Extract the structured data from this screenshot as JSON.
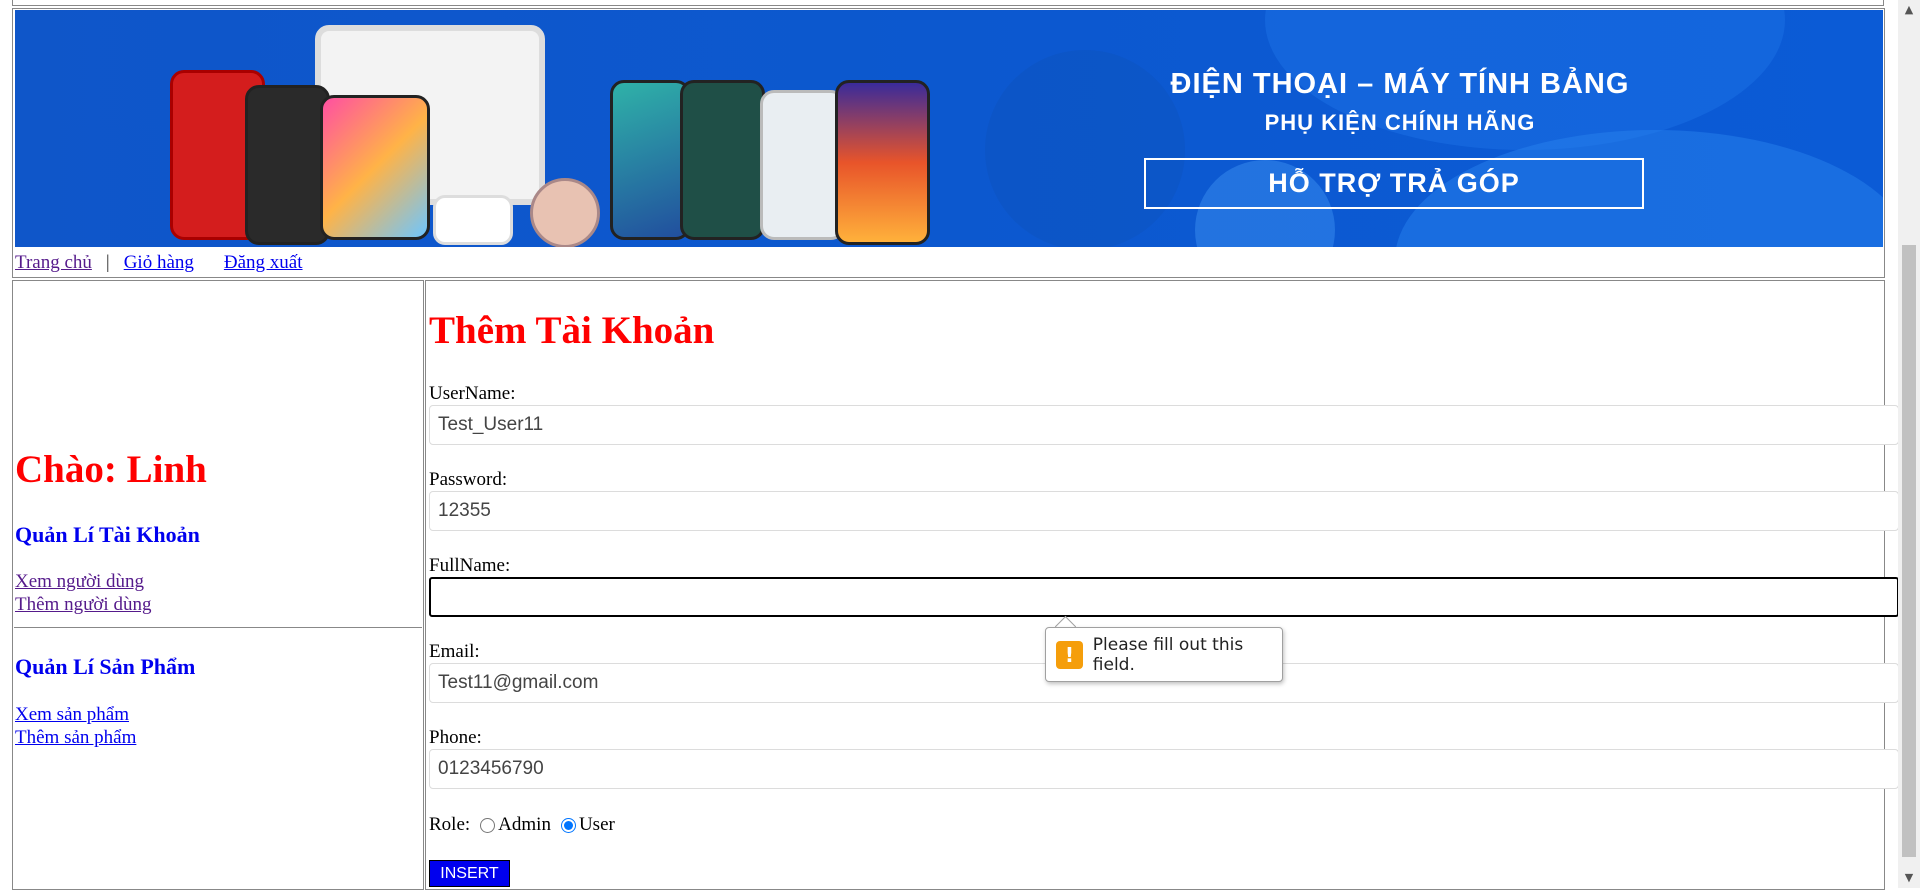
{
  "banner": {
    "title": "ĐIỆN THOẠI – MÁY TÍNH BẢNG",
    "subtitle": "PHỤ KIỆN CHÍNH HÃNG",
    "cta": "HỖ TRỢ TRẢ GÓP"
  },
  "nav": {
    "home": "Trang chủ",
    "separator": "|",
    "cart": "Giỏ hàng",
    "logout": "Đăng xuất"
  },
  "sidebar": {
    "greeting": "Chào: Linh",
    "accounts_title": "Quản Lí Tài Khoản",
    "view_users": "Xem người dùng",
    "add_user": "Thêm người dùng",
    "products_title": "Quản Lí Sản Phẩm",
    "view_products": "Xem sản phẩm",
    "add_product": "Thêm sản phẩm"
  },
  "form": {
    "title": "Thêm Tài Khoản",
    "username_label": "UserName:",
    "username_value": "Test_User11",
    "password_label": "Password:",
    "password_value": "12355",
    "fullname_label": "FullName:",
    "fullname_value": "",
    "email_label": "Email:",
    "email_value": "Test11@gmail.com",
    "phone_label": "Phone:",
    "phone_value": "0123456790",
    "role_label": "Role:",
    "role_admin": "Admin",
    "role_user": "User",
    "role_selected": "User",
    "submit_label": "INSERT"
  },
  "validation": {
    "message": "Please fill out this field.",
    "icon": "!"
  },
  "colors": {
    "heading_red": "#ff0000",
    "link_blue": "#0000ee",
    "banner_blue": "#0c58cf",
    "button_blue": "#0000ee",
    "warning_orange": "#f59e0b"
  }
}
